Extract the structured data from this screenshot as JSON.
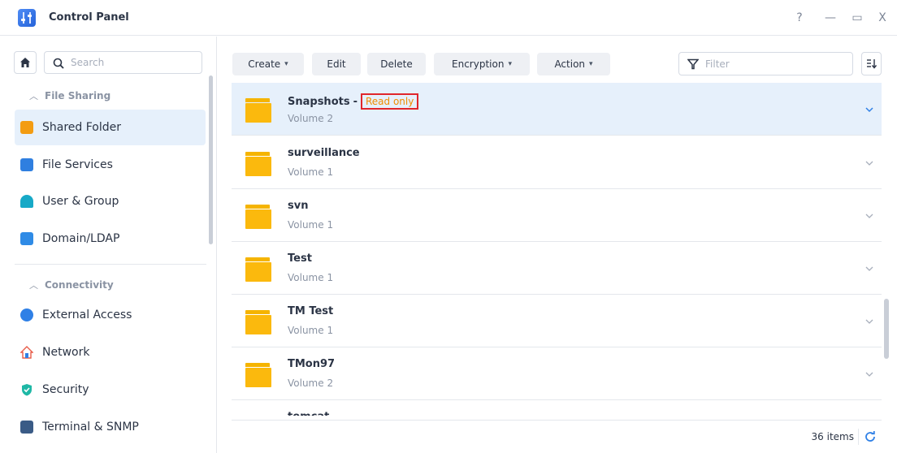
{
  "window": {
    "title": "Control Panel",
    "help_label": "?",
    "minimize_label": "—",
    "maximize_label": "▭",
    "close_label": "X"
  },
  "sidebar": {
    "search_placeholder": "Search",
    "sections": [
      {
        "title": "File Sharing",
        "items": [
          {
            "label": "Shared Folder",
            "icon": "shared-folder-icon",
            "color": "#f39c12",
            "active": true
          },
          {
            "label": "File Services",
            "icon": "file-services-icon",
            "color": "#2f7fe0"
          },
          {
            "label": "User & Group",
            "icon": "user-group-icon",
            "color": "#17a9c7"
          },
          {
            "label": "Domain/LDAP",
            "icon": "domain-ldap-icon",
            "color": "#2f8be6"
          }
        ]
      },
      {
        "title": "Connectivity",
        "items": [
          {
            "label": "External Access",
            "icon": "external-access-icon",
            "color": "#2f80e6"
          },
          {
            "label": "Network",
            "icon": "network-icon",
            "color": "#e85d4a"
          },
          {
            "label": "Security",
            "icon": "security-icon",
            "color": "#1fb8a6"
          },
          {
            "label": "Terminal & SNMP",
            "icon": "terminal-icon",
            "color": "#3a5b86"
          }
        ]
      }
    ]
  },
  "toolbar": {
    "create_label": "Create",
    "edit_label": "Edit",
    "delete_label": "Delete",
    "encryption_label": "Encryption",
    "action_label": "Action",
    "filter_placeholder": "Filter"
  },
  "folders": [
    {
      "name": "Snapshots",
      "volume": "Volume 2",
      "separator": "-",
      "badge": "Read only",
      "selected": true
    },
    {
      "name": "surveillance",
      "volume": "Volume 1"
    },
    {
      "name": "svn",
      "volume": "Volume 1"
    },
    {
      "name": "Test",
      "volume": "Volume 1"
    },
    {
      "name": "TM Test",
      "volume": "Volume 1"
    },
    {
      "name": "TMon97",
      "volume": "Volume 2"
    },
    {
      "name": "tomcat",
      "volume": ""
    }
  ],
  "footer": {
    "count_label": "36 items"
  },
  "colors": {
    "accent": "#2f80e6",
    "selected_bg": "#e6f0fb",
    "folder": "#fbb90d",
    "badge_border": "#e0262b",
    "badge_text": "#f08c00"
  }
}
